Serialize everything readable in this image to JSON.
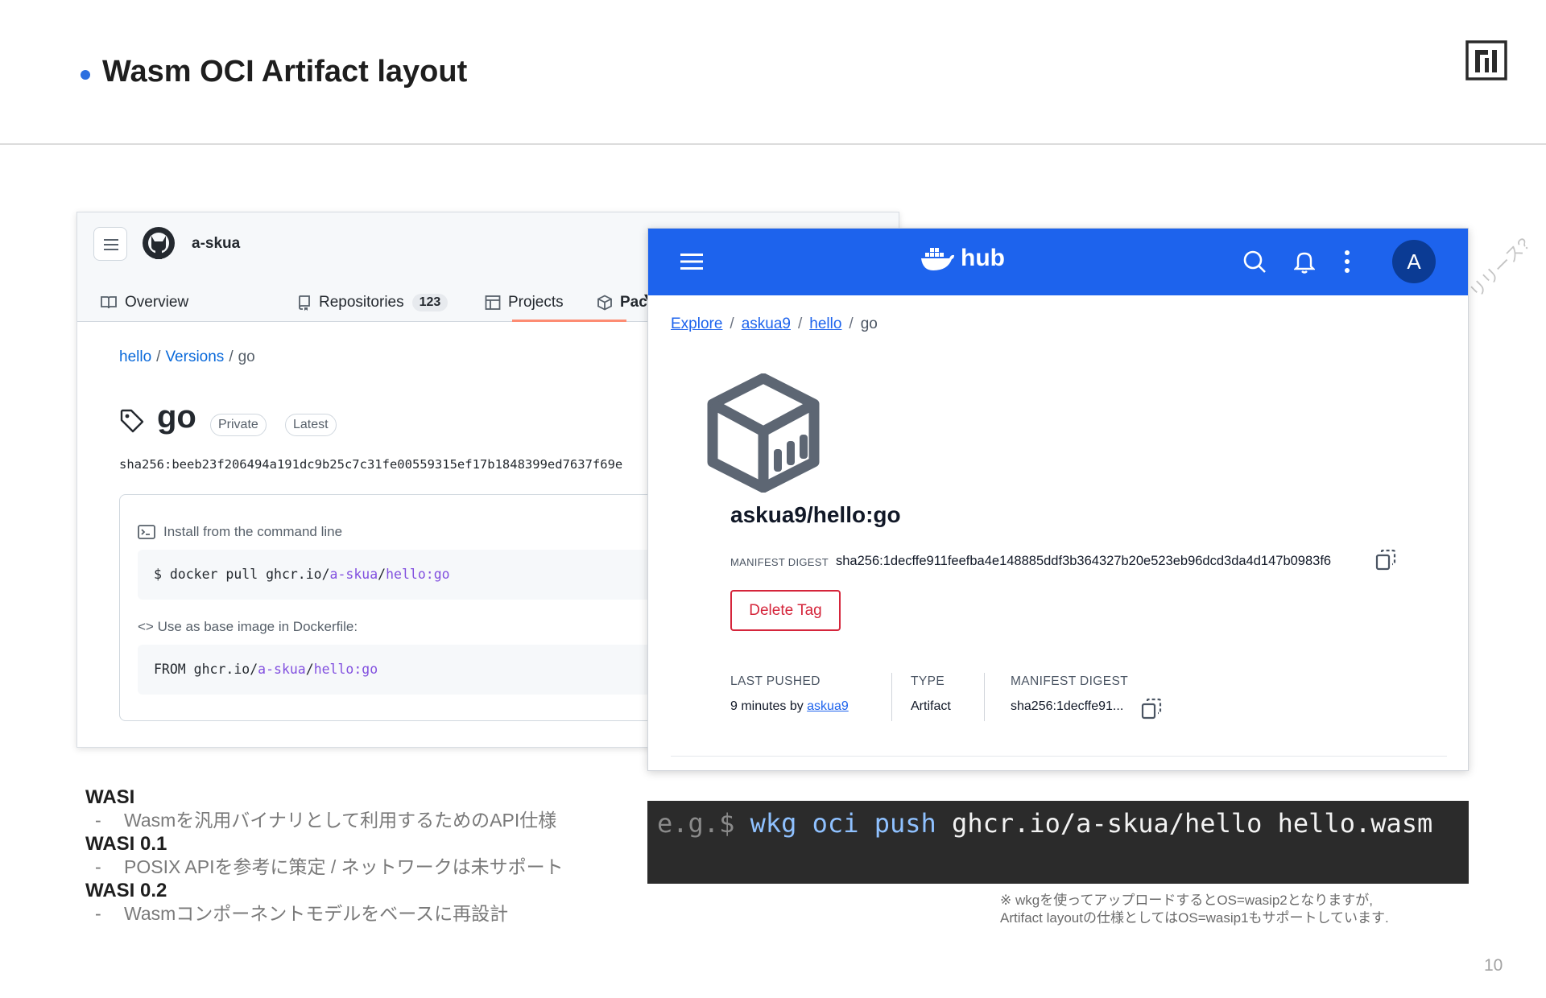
{
  "slide": {
    "title": "Wasm OCI Artifact layout",
    "page_number": "10",
    "side_text": "リリース?",
    "accent_color": "#2b6fe0"
  },
  "github": {
    "owner": "a-skua",
    "tabs": [
      {
        "label": "Overview",
        "icon": "book-icon"
      },
      {
        "label": "Repositories",
        "icon": "repo-icon",
        "count": "123"
      },
      {
        "label": "Projects",
        "icon": "table-icon"
      },
      {
        "label": "Packages",
        "icon": "package-icon",
        "active": true
      }
    ],
    "breadcrumb": [
      "hello",
      "Versions",
      "go"
    ],
    "package_name": "go",
    "labels": [
      "Private",
      "Latest"
    ],
    "sha": "sha256:beeb23f206494a191dc9b25c7c31fe00559315ef17b1848399ed7637f69e",
    "install_heading": "Install from the command line",
    "install_cmd": {
      "prefix": "$ docker pull ghcr.io/",
      "owner": "a-skua",
      "sep": "/",
      "image": "hello:go"
    },
    "base_heading": "Use as base image in Dockerfile:",
    "base_cmd": {
      "prefix": "FROM ghcr.io/",
      "owner": "a-skua",
      "sep": "/",
      "image": "hello:go"
    }
  },
  "dockerhub": {
    "logo_text": "hub",
    "avatar_letter": "A",
    "brand_color": "#1d63ed",
    "breadcrumb": [
      "Explore",
      "askua9",
      "hello",
      "go"
    ],
    "title": "askua9/hello:go",
    "manifest_digest_label": "MANIFEST DIGEST",
    "manifest_digest": "sha256:1decffe911feefba4e148885ddf3b364327b20e523eb96dcd3da4d147b0983f6",
    "delete_label": "Delete Tag",
    "last_pushed_label": "LAST PUSHED",
    "last_pushed_prefix": "9 minutes by ",
    "last_pushed_user": "askua9",
    "type_label": "TYPE",
    "type_value": "Artifact",
    "digest_col_label": "MANIFEST DIGEST",
    "digest_short": "sha256:1decffe91..."
  },
  "wasi": [
    {
      "heading": "WASI",
      "item": "Wasmを汎用バイナリとして利用するためのAPI仕様"
    },
    {
      "heading": "WASI 0.1",
      "item": "POSIX APIを参考に策定 / ネットワークは未サポート"
    },
    {
      "heading": "WASI 0.2",
      "item": "Wasmコンポーネントモデルをベースに再設計"
    }
  ],
  "command": {
    "prefix": "e.g.$",
    "keyword": "wkg oci push",
    "rest": "ghcr.io/a-skua/hello hello.wasm"
  },
  "footnote": {
    "line1": "※ wkgを使ってアップロードするとOS=wasip2となりますが,",
    "line2": "Artifact layoutの仕様としてはOS=wasip1もサポートしています."
  }
}
